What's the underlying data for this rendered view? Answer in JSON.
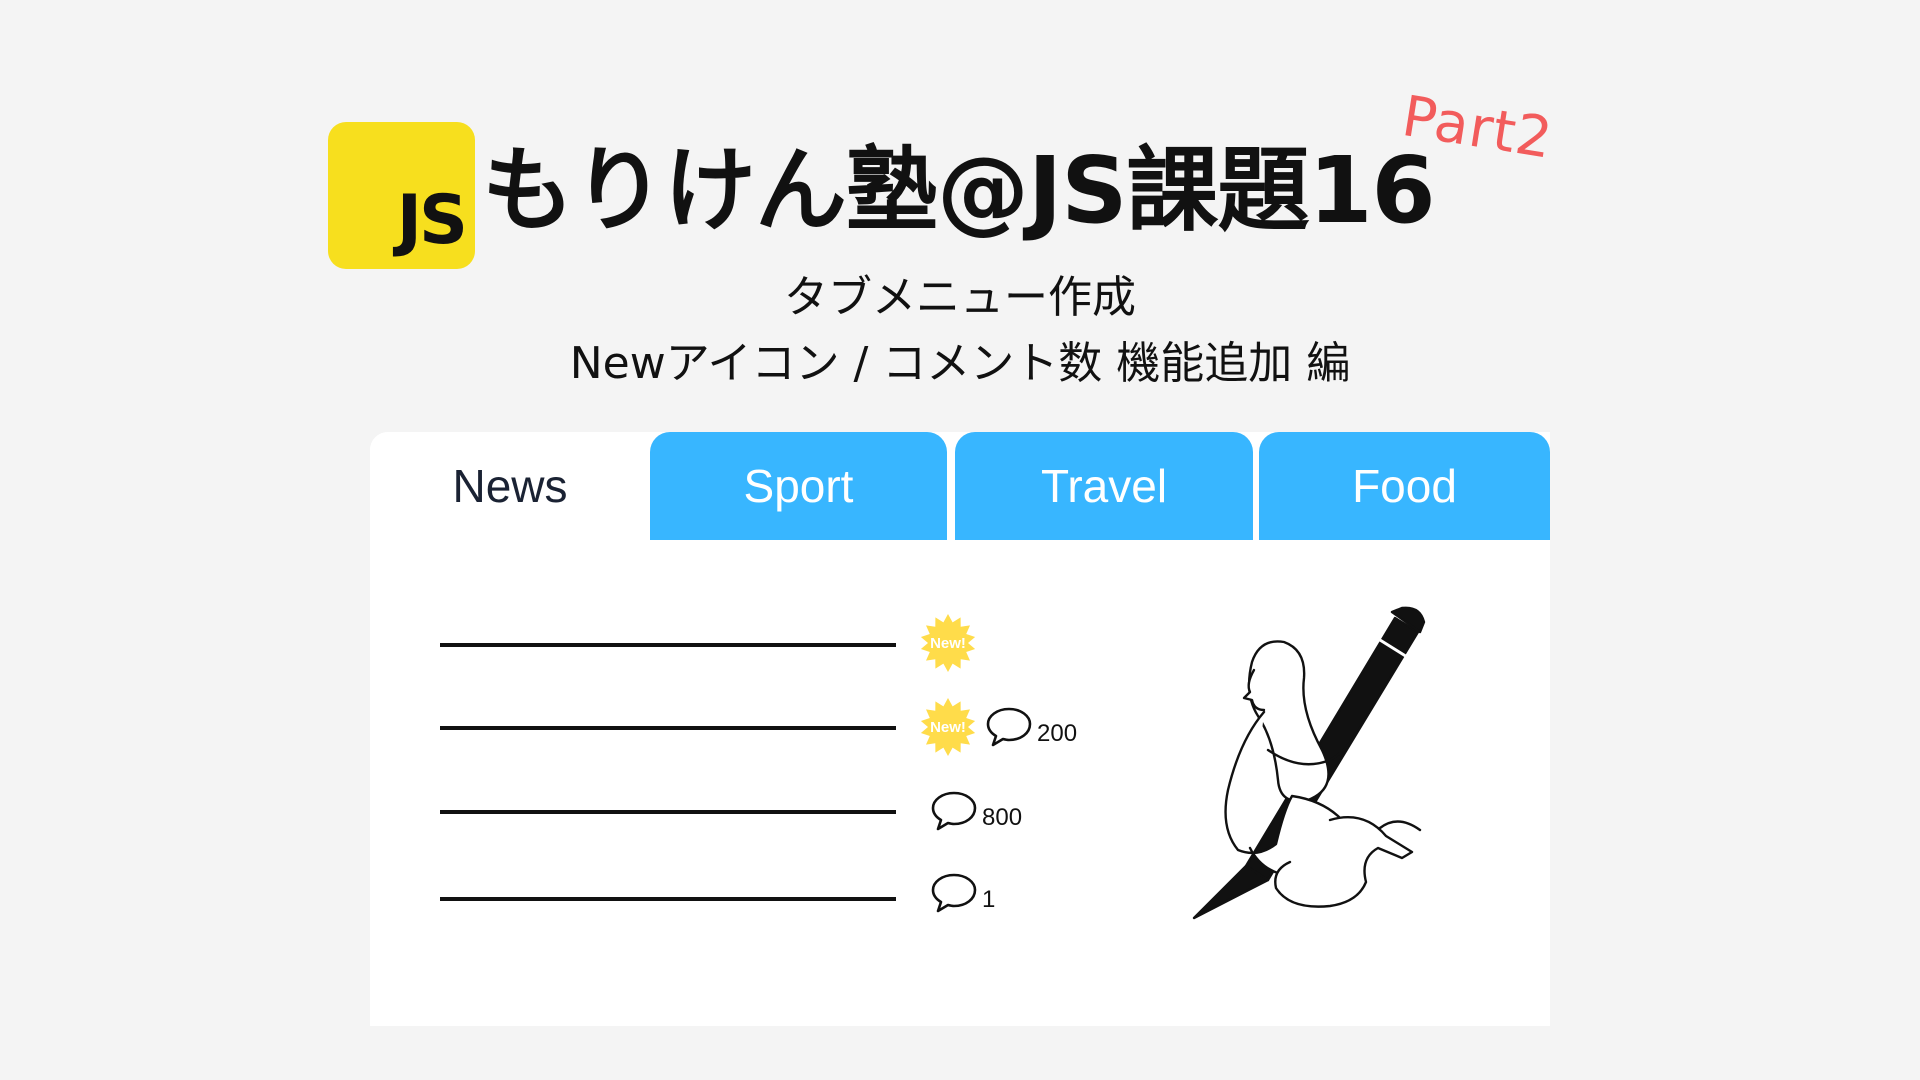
{
  "header": {
    "logo_text": "JS",
    "title": "もりけん塾@JS課題16",
    "part": "Part2",
    "subtitle_line1": "タブメニュー作成",
    "subtitle_line2": "Newアイコン / コメント数 機能追加 編"
  },
  "tabs": [
    {
      "label": "News",
      "active": true
    },
    {
      "label": "Sport",
      "active": false
    },
    {
      "label": "Travel",
      "active": false
    },
    {
      "label": "Food",
      "active": false
    }
  ],
  "news_items": [
    {
      "new_badge": "New!",
      "comments": ""
    },
    {
      "new_badge": "New!",
      "comments": "200"
    },
    {
      "new_badge": "",
      "comments": "800"
    },
    {
      "new_badge": "",
      "comments": "1"
    }
  ],
  "colors": {
    "background": "#f4f4f4",
    "js_yellow": "#f7df1e",
    "tab_blue": "#38b6ff",
    "badge_yellow": "#ffdc4a",
    "part_red": "#f25c5c"
  },
  "icons": {
    "badge": "starburst-badge-icon",
    "comment": "speech-bubble-icon",
    "illustration": "woman-with-pencil-illustration"
  }
}
